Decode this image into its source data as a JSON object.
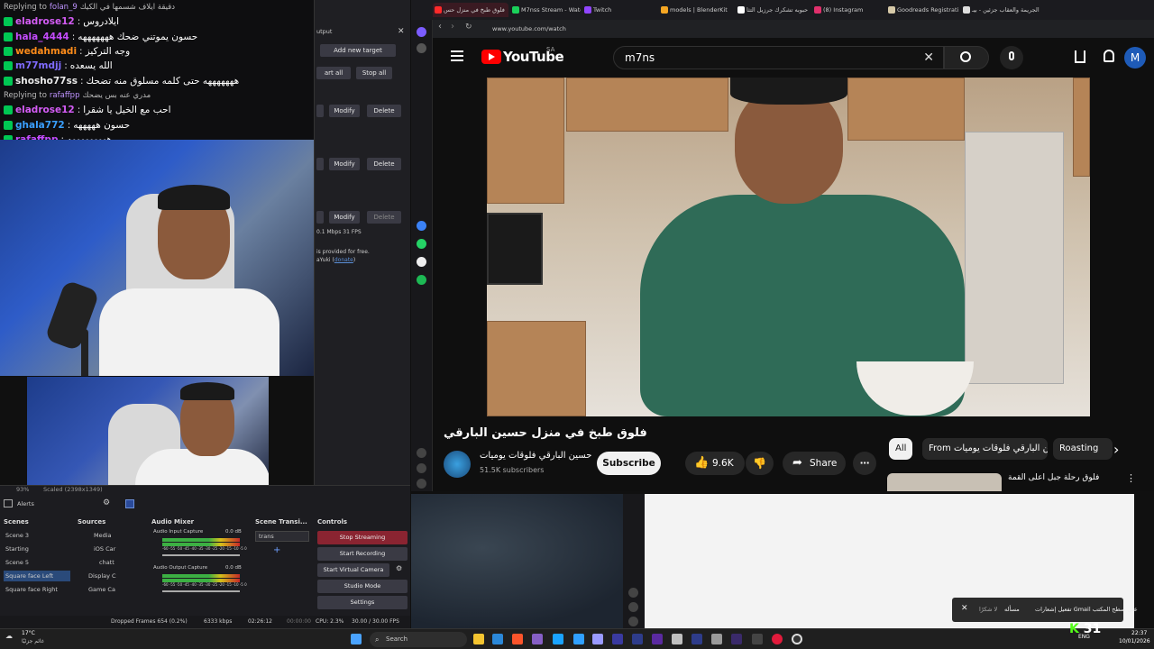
{
  "chat": {
    "lines": [
      {
        "type": "reply",
        "text": "Replying to",
        "user": "folan_9",
        "msg": "دقيقة ايلاف شسمها في الكيك"
      },
      {
        "type": "msg",
        "user": "eladrose12",
        "user_color": "#d45cf5",
        "msg": "ايلادروس"
      },
      {
        "type": "msg",
        "user": "hala_4444",
        "user_color": "#c54cff",
        "msg": "حسون يموتني ضحك هههههههه"
      },
      {
        "type": "msg",
        "user": "wedahmadi",
        "user_color": "#ff8c1a",
        "msg": "وجه التركيز"
      },
      {
        "type": "msg",
        "user": "m77mdjj",
        "user_color": "#7f6bff",
        "msg": "الله يسعده"
      },
      {
        "type": "msg",
        "user": "shosho77ss",
        "user_color": "#e9e9e9",
        "msg": "هههههههه حتى كلمه مسلوق منه تضحك"
      },
      {
        "type": "reply",
        "text": "Replying to",
        "user": "rafaffpp",
        "msg": "مدري عنه بس يضحك"
      },
      {
        "type": "msg",
        "user": "eladrose12",
        "user_color": "#d45cf5",
        "msg": "احب مع الخيل يا شقرا"
      },
      {
        "type": "msg",
        "user": "ghala772",
        "user_color": "#3aa0ff",
        "msg": "حسون هههههه"
      },
      {
        "type": "msg",
        "user": "rafaffpp",
        "user_color": "#c54cff",
        "msg": "هههههههههه"
      }
    ]
  },
  "obs": {
    "panel_title": "utput",
    "add_new_target": "Add new target",
    "start_all": "art all",
    "stop_all": "Stop all",
    "modify": "Modify",
    "delete": "Delete",
    "stats": "0.1 Mbps  31 FPS",
    "credit_line1": "is provided for free.",
    "credit_line2": "aYuki (",
    "credit_link": "donate",
    "credit_end": ")",
    "zoom": "93%",
    "scene_label": "Scaled (2398x1349)",
    "alerts": "Alerts",
    "scenes_title": "Scenes",
    "scenes": [
      "Scene 3",
      "Starting",
      "Scene 5",
      "Square face Left",
      "Square face Right"
    ],
    "sources_title": "Sources",
    "sources": [
      "Media",
      "iOS Car",
      "chatt",
      "Display C",
      "Game Ca"
    ],
    "mixer_title": "Audio Mixer",
    "mixer_input": "Audio Input Capture",
    "mixer_output": "Audio Output Capture",
    "mixer_db": "0.0 dB",
    "mixer_scale": "-60 -55 -50 -45 -40 -35 -30 -25 -20 -15 -10 -5 0",
    "transitions_title": "Scene Transi...",
    "transition": "trans",
    "controls_title": "Controls",
    "controls": [
      "Stop Streaming",
      "Start Recording",
      "Start Virtual Camera",
      "Studio Mode",
      "Settings"
    ],
    "status": {
      "dropped": "Dropped Frames 654 (0.2%)",
      "kbps": "6333 kbps",
      "stream_time": "02:26:12",
      "rec_time": "00:00:00",
      "cpu": "CPU: 2.3%",
      "fps": "30.00 / 30.00 FPS"
    }
  },
  "browser": {
    "tabs": [
      {
        "label": "فلوق طبخ في منزل حس",
        "color": "#ff2a2a"
      },
      {
        "label": "M7nss Stream - Watc",
        "color": "#1ad05a"
      },
      {
        "label": "Twitch",
        "color": "#9146ff"
      },
      {
        "label": "models | BlenderKit",
        "color": "#f5a623"
      },
      {
        "label": "يا حبوبه تشكرك جرزيل التثا",
        "color": "#ffffff"
      },
      {
        "label": "(8) Instagram",
        "color": "#e1306c"
      },
      {
        "label": "Goodreads Registration",
        "color": "#d6c9a8"
      },
      {
        "label": "الجريمة والعقاب جزئين - بيـ",
        "color": "#dddddd"
      }
    ],
    "url": "www.youtube.com/watch"
  },
  "youtube": {
    "logo": "YouTube",
    "logo_region": "SA",
    "search_query": "m7ns",
    "video_title": "فلوق طبخ في منزل حسين البارقي",
    "channel_name": "حسين البارقي فلوقات يوميات",
    "subscribers": "51.5K subscribers",
    "subscribe": "Subscribe",
    "likes": "9.6K",
    "share": "Share",
    "avatar_letter": "M",
    "chips": [
      "All",
      "From حسين البارقي فلوقات يوميات",
      "Roasting"
    ],
    "rec_title": "فلوق رحلة جبل اعلى القمة"
  },
  "toast": {
    "text": "تفعيل إشعارات Gmail على سطح المكتب",
    "action1": "مسأله",
    "action2": "لا شكرًا"
  },
  "taskbar": {
    "weather_temp": "17°C",
    "weather_text": "غائم جزئيًا",
    "search": "Search",
    "time": "22:37",
    "date": "10/01/2026",
    "lang": "ENG",
    "kick_count": "31"
  }
}
